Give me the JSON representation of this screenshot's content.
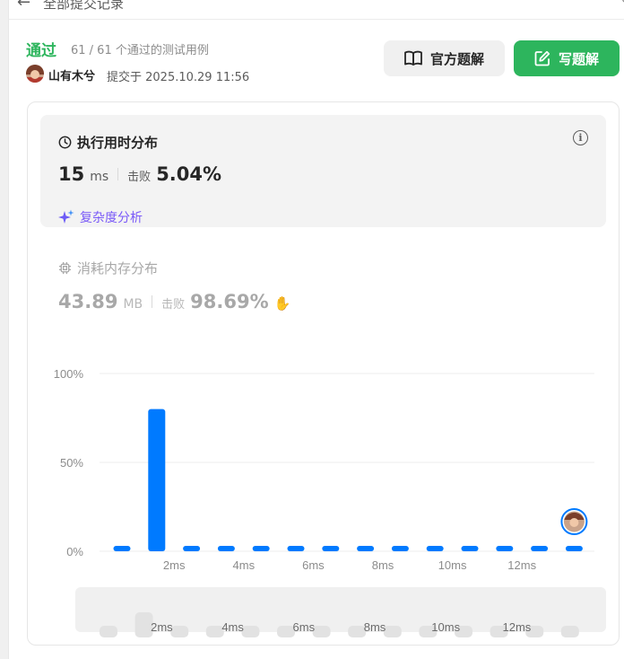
{
  "header": {
    "back_icon": "arrow-left-icon",
    "title": "全部提交记录",
    "corner_text": "c"
  },
  "submission": {
    "status": "通过",
    "passed_text": "61 / 61 个通过的测试用例",
    "username": "山有木兮",
    "submitted_text": "提交于 2025.10.29 11:56"
  },
  "buttons": {
    "solution_label": "官方题解",
    "write_label": "写题解"
  },
  "runtime": {
    "title": "执行用时分布",
    "value": "15",
    "unit": "ms",
    "beat_label": "击败",
    "beat_value": "5.04%",
    "complexity_label": "复杂度分析"
  },
  "memory": {
    "title": "消耗内存分布",
    "value": "43.89",
    "unit": "MB",
    "beat_label": "击败",
    "beat_value": "98.69%"
  },
  "colors": {
    "accent_green": "#2db55d",
    "bar_blue": "#007aff",
    "complexity_purple": "#7a5af8"
  },
  "chart_data": {
    "type": "bar",
    "title": "执行用时分布",
    "y_ticks": [
      "100%",
      "50%",
      "0%"
    ],
    "x_ticks": [
      "2ms",
      "4ms",
      "6ms",
      "8ms",
      "10ms",
      "12ms"
    ],
    "ylim": [
      0,
      100
    ],
    "values": [
      3,
      80,
      3,
      3,
      3,
      3,
      3,
      3,
      3,
      3,
      3,
      3,
      3,
      3
    ],
    "current_index": 13,
    "mini_values": [
      3,
      18,
      3,
      3,
      3,
      3,
      3,
      3,
      3,
      3,
      3,
      3,
      3,
      3
    ],
    "grid": true
  }
}
